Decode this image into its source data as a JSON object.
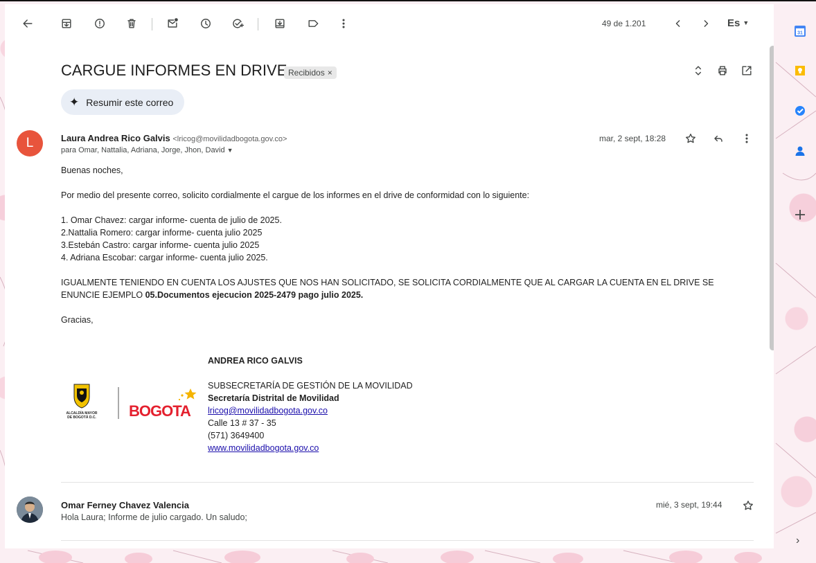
{
  "toolbar": {
    "icons": [
      "back-arrow-icon",
      "archive-icon",
      "report-spam-icon",
      "delete-icon",
      "mark-unread-icon",
      "snooze-icon",
      "add-task-icon",
      "move-to-icon",
      "label-icon",
      "more-vert-icon"
    ],
    "counter": "49 de 1.201",
    "language": "Es"
  },
  "email": {
    "subject": "CARGUE INFORMES EN DRIVE",
    "label": "Recibidos",
    "label_close": "×",
    "summarize_label": "Resumir este correo",
    "summarize_icon": "✦",
    "message": {
      "avatar_letter": "L",
      "sender_name": "Laura Andrea Rico Galvis",
      "sender_email": "<lricog@movilidadbogota.gov.co>",
      "recipients": "para Omar, Nattalia, Adriana, Jorge, Jhon, David",
      "date": "mar, 2 sept, 18:28",
      "greeting": "Buenas noches,",
      "intro": "Por medio del presente correo, solicito cordialmente el cargue de los informes en el drive de conformidad con lo siguiente:",
      "list": [
        "1. Omar Chavez: cargar informe- cuenta de julio de 2025.",
        "2.Nattalia Romero: cargar informe- cuenta julio 2025",
        "3.Estebán Castro: cargar informe- cuenta julio 2025",
        "4. Adriana Escobar: cargar informe- cuenta julio 2025."
      ],
      "notice_text": "IGUALMENTE TENIENDO EN CUENTA LOS AJUSTES QUE NOS HAN SOLICITADO, SE SOLICITA CORDIALMENTE QUE AL CARGAR LA CUENTA EN EL DRIVE SE ENUNCIE EJEMPLO ",
      "notice_bold": "05.Documentos ejecucion 2025-2479 pago julio 2025.",
      "closing": "Gracias,",
      "signature": {
        "name": "ANDREA RICO GALVIS",
        "office": "SUBSECRETARÍA DE GESTIÓN DE LA MOVILIDAD",
        "entity": "Secretaría Distrital de Movilidad",
        "email": "lricog@movilidadbogota.gov.co",
        "address": "Calle 13 # 37 - 35",
        "phone": "(571) 3649400",
        "website": "www.movilidadbogota.gov.co"
      },
      "logo_text_1": "ALCALDÍA MAYOR DE BOGOTÁ D.C.",
      "logo_text_2": "BOGOTÁ"
    },
    "reply": {
      "sender_name": "Omar Ferney Chavez Valencia",
      "snippet": "Hola Laura; Informe de julio cargado. Un saludo;",
      "date": "mié, 3 sept, 19:44"
    }
  },
  "side_rail": {
    "icons": [
      "calendar-icon",
      "keep-icon",
      "tasks-icon",
      "contacts-icon",
      "add-icon",
      "expand-arrow-icon"
    ],
    "calendar_day": "31"
  },
  "colors": {
    "avatar_L": "#e8543c",
    "bogota_red": "#e4202e",
    "star_yellow": "#f5b400",
    "link": "#1a0dab"
  }
}
